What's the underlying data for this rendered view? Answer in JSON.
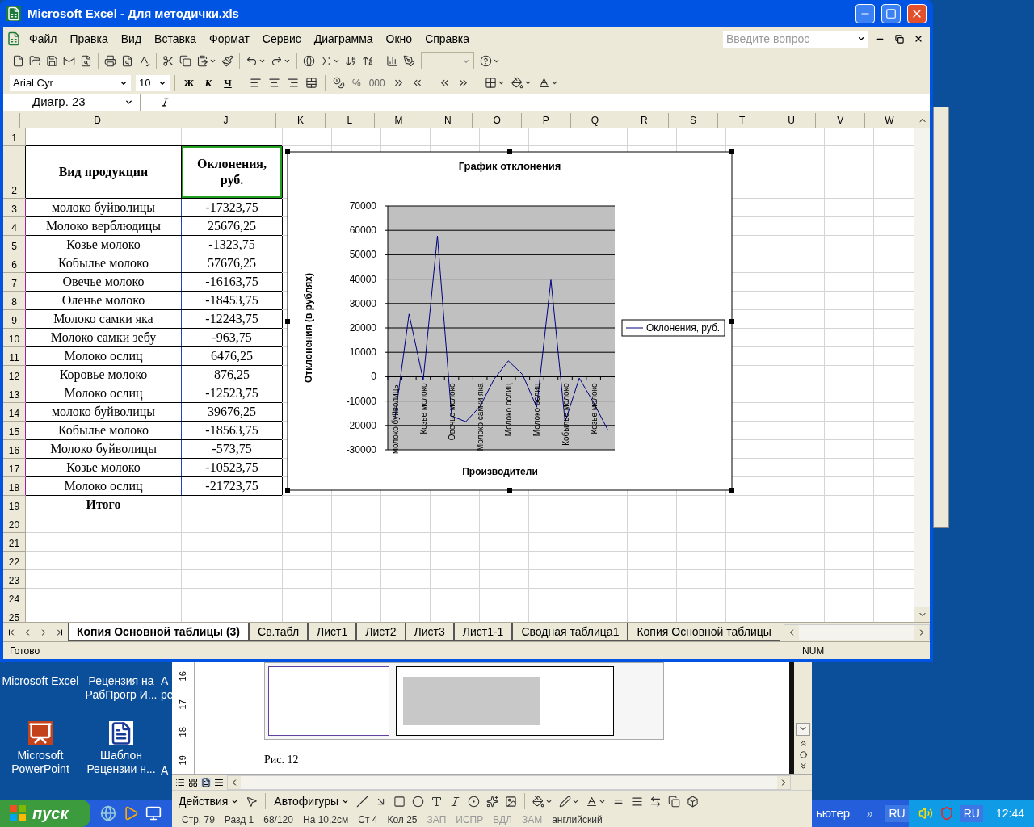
{
  "excel": {
    "title": "Microsoft Excel - Для методички.xls",
    "menu": [
      "Файл",
      "Правка",
      "Вид",
      "Вставка",
      "Формат",
      "Сервис",
      "Диаграмма",
      "Окно",
      "Справка"
    ],
    "help_placeholder": "Введите вопрос",
    "font_name": "Arial Cyr",
    "font_size": "10",
    "format_buttons": [
      "Ж",
      "К",
      "Ч"
    ],
    "number_buttons": [
      "%",
      "000"
    ],
    "name_box": "Диагр. 23",
    "columns": [
      "D",
      "J",
      "K",
      "L",
      "M",
      "N",
      "O",
      "P",
      "Q",
      "R",
      "S",
      "T",
      "U",
      "V",
      "W"
    ],
    "row_numbers": [
      "1",
      "2",
      "3",
      "4",
      "5",
      "6",
      "7",
      "8",
      "9",
      "10",
      "11",
      "12",
      "13",
      "14",
      "15",
      "16",
      "17",
      "18",
      "19",
      "20",
      "21",
      "22",
      "23",
      "24",
      "25"
    ],
    "header": [
      "Вид продукции",
      "Оклонения, руб."
    ],
    "rows": [
      {
        "product": "молоко буйволицы",
        "value": "-17323,75"
      },
      {
        "product": "Молоко верблюдицы",
        "value": "25676,25"
      },
      {
        "product": "Козье молоко",
        "value": "-1323,75"
      },
      {
        "product": "Кобылье молоко",
        "value": "57676,25"
      },
      {
        "product": "Овечье молоко",
        "value": "-16163,75"
      },
      {
        "product": "Оленье молоко",
        "value": "-18453,75"
      },
      {
        "product": "Молоко самки яка",
        "value": "-12243,75"
      },
      {
        "product": "Молоко самки зебу",
        "value": "-963,75"
      },
      {
        "product": "Молоко ослиц",
        "value": "6476,25"
      },
      {
        "product": "Коровье молоко",
        "value": "876,25"
      },
      {
        "product": "Молоко ослиц",
        "value": "-12523,75"
      },
      {
        "product": "молоко буйволицы",
        "value": "39676,25"
      },
      {
        "product": "Кобылье молоко",
        "value": "-18563,75"
      },
      {
        "product": "Молоко буйволицы",
        "value": "-573,75"
      },
      {
        "product": "Козье молоко",
        "value": "-10523,75"
      },
      {
        "product": "Молоко ослиц",
        "value": "-21723,75"
      }
    ],
    "total_label": "Итого",
    "chart": {
      "chart_data": {
        "type": "line",
        "title": "График отклонения",
        "xlabel": "Производители",
        "ylabel": "Отклонения (в рублях)",
        "categories": [
          "молоко буйволицы",
          null,
          "Козье молоко",
          null,
          "Овечье молоко",
          null,
          "Молоко самки яка",
          null,
          "Молоко ослиц",
          null,
          "Молоко ослиц",
          null,
          "Кобылье молоко",
          null,
          "Козье молоко",
          null
        ],
        "grid": true,
        "series": [
          {
            "name": "Оклонения, руб.",
            "color": "#000080",
            "values": [
              -17323.75,
              25676.25,
              -1323.75,
              57676.25,
              -16163.75,
              -18453.75,
              -12243.75,
              -963.75,
              6476.25,
              876.25,
              -12523.75,
              39676.25,
              -18563.75,
              -573.75,
              -10523.75,
              -21723.75
            ]
          }
        ],
        "ylim": [
          -30000,
          70000
        ],
        "yticks": [
          -30000,
          -20000,
          -10000,
          0,
          10000,
          20000,
          30000,
          40000,
          50000,
          60000,
          70000
        ]
      }
    },
    "sheet_tabs": [
      {
        "label": "Копия Основной таблицы (3)",
        "selected": true
      },
      {
        "label": "Св.табл",
        "selected": false
      },
      {
        "label": "Лист1",
        "selected": false
      },
      {
        "label": "Лист2",
        "selected": false
      },
      {
        "label": "Лист3",
        "selected": false
      },
      {
        "label": "Лист1-1",
        "selected": false
      },
      {
        "label": "Сводная таблица1",
        "selected": false
      },
      {
        "label": "Копия Основной таблицы",
        "selected": false
      }
    ],
    "status": "Готово",
    "status_num": "NUM"
  },
  "desktop_icons": [
    {
      "label": "Microsoft Excel",
      "kind": "hidden"
    },
    {
      "label": "Рецензия на РабПрогр И...",
      "kind": "hidden"
    },
    {
      "label": "Microsoft PowerPoint",
      "kind": "powerpoint"
    },
    {
      "label": "Шаблон Рецензии н...",
      "kind": "word"
    }
  ],
  "desktop_cut_labels": [
    "А",
    "ре",
    "А"
  ],
  "word": {
    "ruler_marks": [
      "16",
      "17",
      "18",
      "19"
    ],
    "caption": "Рис. 12",
    "drawing_toolbar": [
      "Действия",
      "Автофигуры"
    ],
    "status": [
      "Стр. 79",
      "Разд 1",
      "68/120",
      "На 10,2см",
      "Ст 4",
      "Кол 25",
      "ЗАП",
      "ИСПР",
      "ВДЛ",
      "ЗАМ",
      "английский"
    ]
  },
  "taskbar": {
    "start": "пуск",
    "task": "ьютер",
    "more": "»",
    "lang": "RU",
    "tray_lang": "RU",
    "clock": "12:44"
  }
}
